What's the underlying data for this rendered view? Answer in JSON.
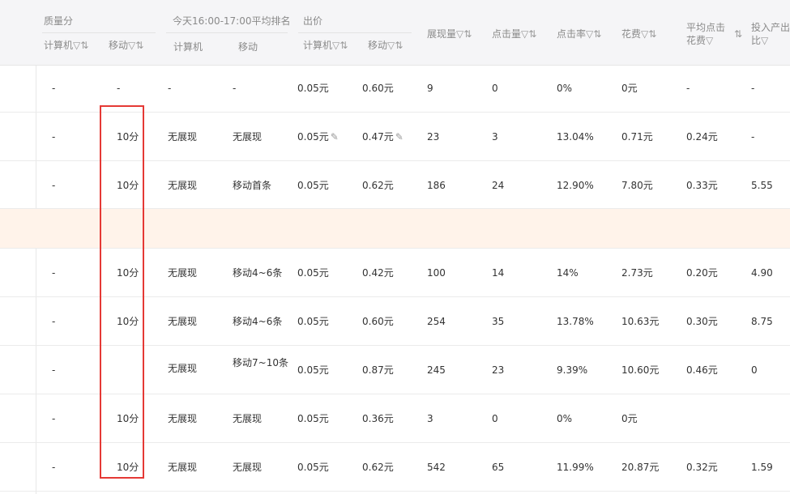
{
  "header": {
    "groups": {
      "quality": "质量分",
      "ranking": "今天16:00-17:00平均排名",
      "bid": "出价"
    },
    "sub": {
      "q_pc": "计算机",
      "q_mobile": "移动",
      "r_pc": "计算机",
      "r_mobile": "移动",
      "b_pc": "计算机",
      "b_mobile": "移动"
    },
    "metrics": {
      "impressions": "展现量",
      "clicks": "点击量",
      "ctr": "点击率",
      "cost": "花费",
      "avg_cpc_line1": "平均点击",
      "avg_cpc_line2": "花费",
      "roi_line1": "投入产出",
      "roi_line2": "比"
    },
    "filter_icon": "▽",
    "sort_icon": "⇅"
  },
  "rows": [
    {
      "q_pc": "-",
      "q_mobile": "-",
      "r_pc": "-",
      "r_mobile": "-",
      "b_pc": "0.05元",
      "b_mobile": "0.60元",
      "impressions": "9",
      "clicks": "0",
      "ctr": "0%",
      "cost": "0元",
      "avg_cpc": "-",
      "roi": "-"
    },
    {
      "q_pc": "-",
      "q_mobile": "10分",
      "r_pc": "无展现",
      "r_mobile": "无展现",
      "b_pc": "0.05元",
      "b_mobile": "0.47元",
      "impressions": "23",
      "clicks": "3",
      "ctr": "13.04%",
      "cost": "0.71元",
      "avg_cpc": "0.24元",
      "roi": "-"
    },
    {
      "q_pc": "-",
      "q_mobile": "10分",
      "r_pc": "无展现",
      "r_mobile": "移动首条",
      "b_pc": "0.05元",
      "b_mobile": "0.62元",
      "impressions": "186",
      "clicks": "24",
      "ctr": "12.90%",
      "cost": "7.80元",
      "avg_cpc": "0.33元",
      "roi": "5.55"
    },
    {
      "q_pc": "-",
      "q_mobile": "10分",
      "r_pc": "无展现",
      "r_mobile": "移动4~6条",
      "b_pc": "0.05元",
      "b_mobile": "0.42元",
      "impressions": "100",
      "clicks": "14",
      "ctr": "14%",
      "cost": "2.73元",
      "avg_cpc": "0.20元",
      "roi": "4.90"
    },
    {
      "q_pc": "-",
      "q_mobile": "10分",
      "r_pc": "无展现",
      "r_mobile": "移动4~6条",
      "b_pc": "0.05元",
      "b_mobile": "0.60元",
      "impressions": "254",
      "clicks": "35",
      "ctr": "13.78%",
      "cost": "10.63元",
      "avg_cpc": "0.30元",
      "roi": "8.75"
    },
    {
      "q_pc": "-",
      "q_mobile": "",
      "r_pc": "无展现",
      "r_mobile": "移动7~10条",
      "b_pc": "0.05元",
      "b_mobile": "0.87元",
      "impressions": "245",
      "clicks": "23",
      "ctr": "9.39%",
      "cost": "10.60元",
      "avg_cpc": "0.46元",
      "roi": "0"
    },
    {
      "q_pc": "-",
      "q_mobile": "10分",
      "r_pc": "无展现",
      "r_mobile": "无展现",
      "b_pc": "0.05元",
      "b_mobile": "0.36元",
      "impressions": "3",
      "clicks": "0",
      "ctr": "0%",
      "cost": "0元",
      "avg_cpc": "",
      "roi": ""
    },
    {
      "q_pc": "-",
      "q_mobile": "10分",
      "r_pc": "无展现",
      "r_mobile": "无展现",
      "b_pc": "0.05元",
      "b_mobile": "0.62元",
      "impressions": "542",
      "clicks": "65",
      "ctr": "11.99%",
      "cost": "20.87元",
      "avg_cpc": "0.32元",
      "roi": "1.59"
    }
  ],
  "colors": {
    "highlight_row": "#fff3ea",
    "annotation_box": "#e53935"
  }
}
